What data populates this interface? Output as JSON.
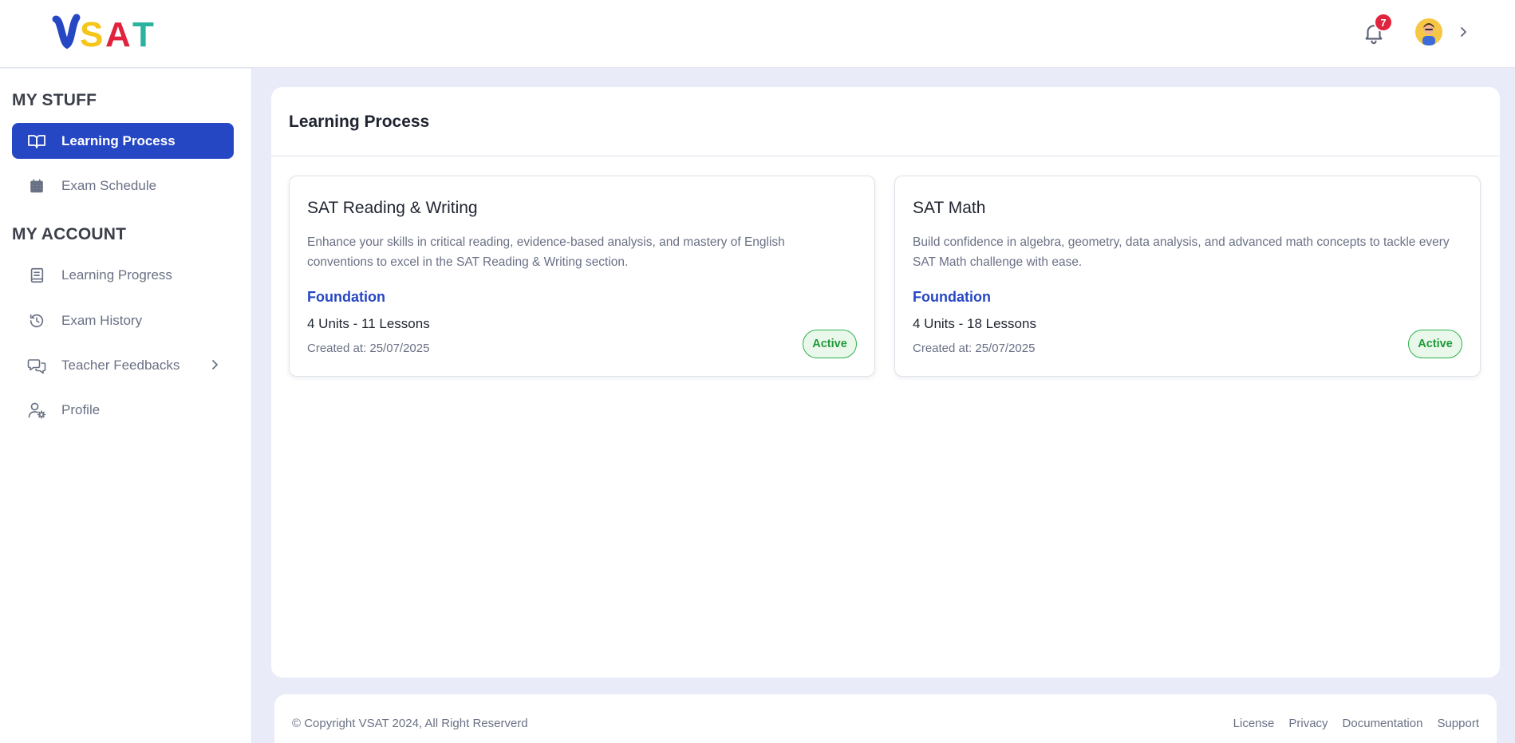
{
  "brand": {
    "logo_text": "VSAT",
    "logo_colors": [
      "#2647c4",
      "#f5c518",
      "#e0243d",
      "#2bb3a0"
    ]
  },
  "header": {
    "notification_count": "7",
    "icons": [
      "bell-icon",
      "avatar",
      "chevron-right-icon"
    ]
  },
  "sidebar": {
    "sections": [
      {
        "title": "MY STUFF",
        "items": [
          {
            "label": "Learning Process",
            "icon": "book-open-icon",
            "active": true
          },
          {
            "label": "Exam Schedule",
            "icon": "calendar-icon",
            "active": false
          }
        ]
      },
      {
        "title": "MY ACCOUNT",
        "items": [
          {
            "label": "Learning Progress",
            "icon": "notebook-icon",
            "active": false
          },
          {
            "label": "Exam History",
            "icon": "history-icon",
            "active": false
          },
          {
            "label": "Teacher Feedbacks",
            "icon": "chat-bubbles-icon",
            "active": false,
            "has_submenu": true
          },
          {
            "label": "Profile",
            "icon": "user-gear-icon",
            "active": false
          }
        ]
      }
    ]
  },
  "main": {
    "title": "Learning Process",
    "courses": [
      {
        "title": "SAT Reading & Writing",
        "description": "Enhance your skills in critical reading, evidence-based analysis, and mastery of English conventions to excel in the SAT Reading & Writing section.",
        "level": "Foundation",
        "units": "4 Units - 11 Lessons",
        "created": "Created at: 25/07/2025",
        "status": "Active"
      },
      {
        "title": "SAT Math",
        "description": "Build confidence in algebra, geometry, data analysis, and advanced math concepts to tackle every SAT Math challenge with ease.",
        "level": "Foundation",
        "units": "4 Units - 18 Lessons",
        "created": "Created at: 25/07/2025",
        "status": "Active"
      }
    ]
  },
  "footer": {
    "copyright": "© Copyright VSAT 2024, All Right Reserverd",
    "links": [
      "License",
      "Privacy",
      "Documentation",
      "Support"
    ]
  },
  "colors": {
    "accent": "#2647c4",
    "status_active": "#1f9a37",
    "badge": "#e0243d",
    "page_background": "#e9ebf8"
  }
}
